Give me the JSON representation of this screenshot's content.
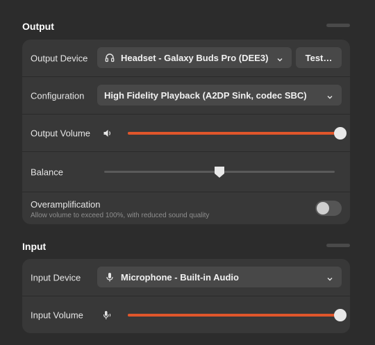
{
  "output": {
    "title": "Output",
    "device": {
      "label": "Output Device",
      "value": "Headset - Galaxy Buds Pro (DEE3)",
      "icon": "headphones-icon"
    },
    "test_button": "Test…",
    "configuration": {
      "label": "Configuration",
      "value": "High Fidelity Playback (A2DP Sink, codec SBC)"
    },
    "volume": {
      "label": "Output Volume",
      "level_fraction": 1.0,
      "icon": "speaker-icon"
    },
    "balance": {
      "label": "Balance",
      "level_fraction": 0.5
    },
    "overamplification": {
      "label": "Overamplification",
      "description": "Allow volume to exceed 100%, with reduced sound quality",
      "enabled": false
    }
  },
  "input": {
    "title": "Input",
    "device": {
      "label": "Input Device",
      "value": "Microphone - Built-in Audio",
      "icon": "microphone-icon"
    },
    "volume": {
      "label": "Input Volume",
      "level_fraction": 1.0,
      "icon": "microphone-level-icon"
    }
  },
  "colors": {
    "accent": "#e0562b",
    "background": "#2c2c2c",
    "card": "#383838",
    "control": "#484848"
  }
}
